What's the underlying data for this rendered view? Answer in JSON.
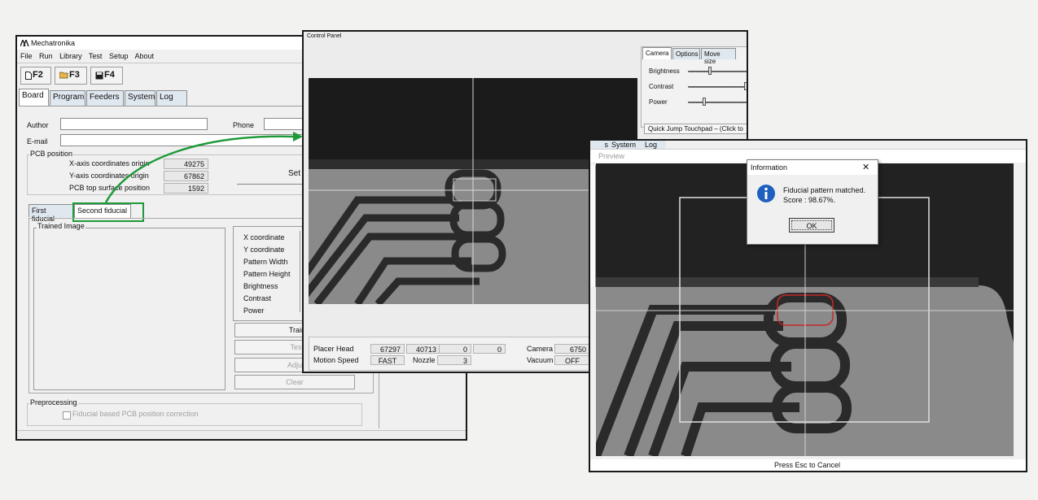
{
  "main_window": {
    "title": "Mechatronika",
    "menu": [
      "File",
      "Run",
      "Library",
      "Test",
      "Setup",
      "About"
    ],
    "toolbar": [
      {
        "label": "F2",
        "icon": "new-document-icon"
      },
      {
        "label": "F3",
        "icon": "open-folder-icon"
      },
      {
        "label": "F4",
        "icon": "save-disk-icon"
      }
    ],
    "tabs": [
      "Board",
      "Program",
      "Feeders",
      "System",
      "Log"
    ],
    "author_label": "Author",
    "phone_label": "Phone",
    "email_label": "E-mail",
    "pcb_group": "PCB position",
    "pcb_rows": [
      {
        "label": "X-axis coordinates origin",
        "value": "49275"
      },
      {
        "label": "Y-axis coordinates origin",
        "value": "67862"
      },
      {
        "label": "PCB top surface position",
        "value": "1592"
      }
    ],
    "set_button": "Set",
    "fiducial_tabs": [
      "First fiducial",
      "Second fiducial"
    ],
    "trained_image": "Trained Image",
    "params": [
      "X coordinate",
      "Y coordinate",
      "Pattern Width",
      "Pattern Height",
      "Brightness",
      "Contrast",
      "Power"
    ],
    "buttons": [
      "Train",
      "Test",
      "Adjust",
      "Clear"
    ],
    "preprocessing": "Preprocessing",
    "fiducial_checkbox": "Fiducial based PCB position correction"
  },
  "control_panel": {
    "title": "Control Panel",
    "tabs": [
      "Camera",
      "Options",
      "Move size"
    ],
    "sliders": [
      {
        "label": "Brightness",
        "level": 0.38
      },
      {
        "label": "Contrast",
        "level": 0.98
      },
      {
        "label": "Power",
        "level": 0.28
      }
    ],
    "quick_jump": "Quick Jump Touchpad – (Click to ",
    "status": {
      "placer_head_label": "Placer Head",
      "placer_head_values": [
        "67297",
        "40713",
        "0",
        "0"
      ],
      "camera_label": "Camera",
      "camera_value": "6750",
      "motion_speed_label": "Motion Speed",
      "motion_speed_value": "FAST",
      "nozzle_label": "Nozzle",
      "nozzle_value": "3",
      "vacuum_label": "Vacuum",
      "vacuum_value": "OFF"
    }
  },
  "preview_window": {
    "title": "Preview",
    "behind_tabs": [
      "s",
      "System",
      "Log"
    ],
    "footer": "Press Esc to Cancel"
  },
  "info_dialog": {
    "title": "Information",
    "close": "✕",
    "message_line1": "Fiducial pattern matched.",
    "message_line2": "Score : 98.67%.",
    "ok": "OK"
  },
  "colors": {
    "highlight_green": "#1f9a3a",
    "match_red": "#c62828",
    "info_blue": "#1f5fbf"
  }
}
